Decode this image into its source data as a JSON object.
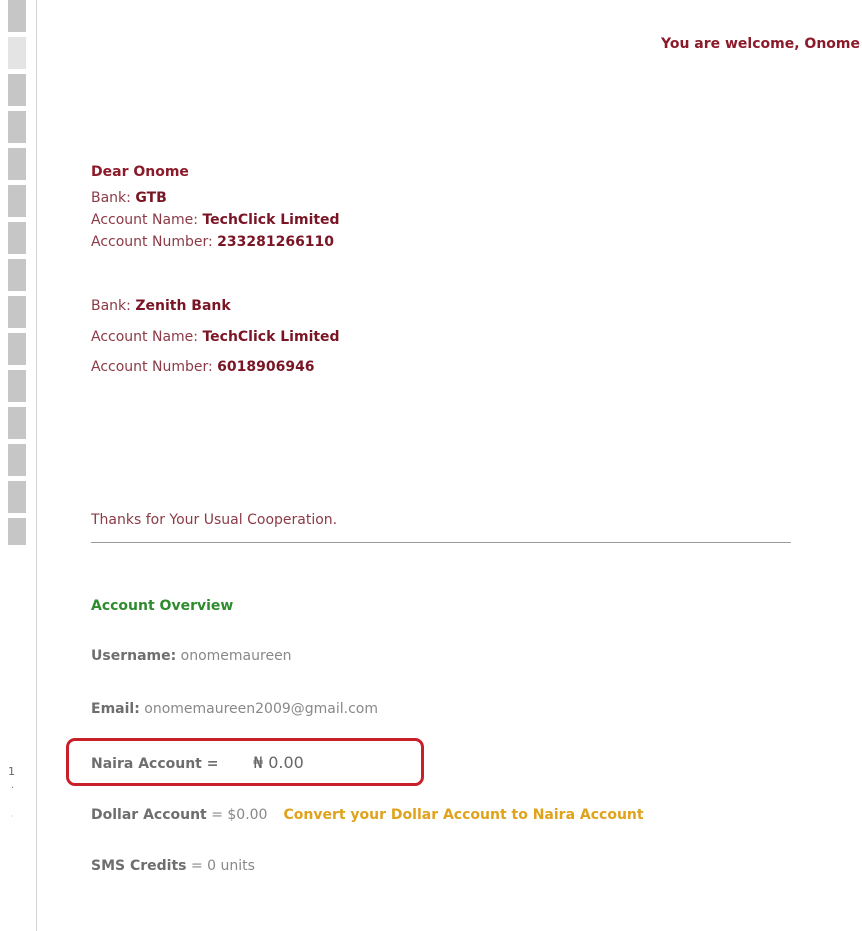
{
  "header": {
    "welcome": "You are welcome,  Onome"
  },
  "message": {
    "greeting": "Dear Onome",
    "banks": [
      {
        "bank_label": "Bank: ",
        "bank_name": "GTB",
        "account_name_label": "Account Name: ",
        "account_name": "TechClick Limited",
        "account_number_label": "Account Number: ",
        "account_number": "233281266110"
      },
      {
        "bank_label": "Bank: ",
        "bank_name": "Zenith Bank",
        "account_name_label": "Account Name: ",
        "account_name": "TechClick Limited",
        "account_number_label": "Account Number: ",
        "account_number": "6018906946"
      }
    ],
    "thanks": "Thanks for Your Usual Cooperation."
  },
  "overview": {
    "title": "Account Overview",
    "username_label": "Username:",
    "username": "onomemaureen",
    "email_label": "Email:",
    "email": "onomemaureen2009@gmail.com",
    "naira_label": "Naira Account =",
    "naira_value": "₦ 0.00",
    "dollar_label": "Dollar Account",
    "dollar_value": " = $0.00",
    "convert_link": "Convert your Dollar Account to Naira Account",
    "sms_label": "SMS Credits",
    "sms_value": " = 0 units"
  },
  "margin": {
    "digit": "1",
    "dot": "·",
    "dot2": "·"
  },
  "colors": {
    "maroon": "#8b1a2a",
    "green_heading": "#2e8b2e",
    "link_orange": "#e0a21a",
    "highlight_red": "#c8202a"
  }
}
